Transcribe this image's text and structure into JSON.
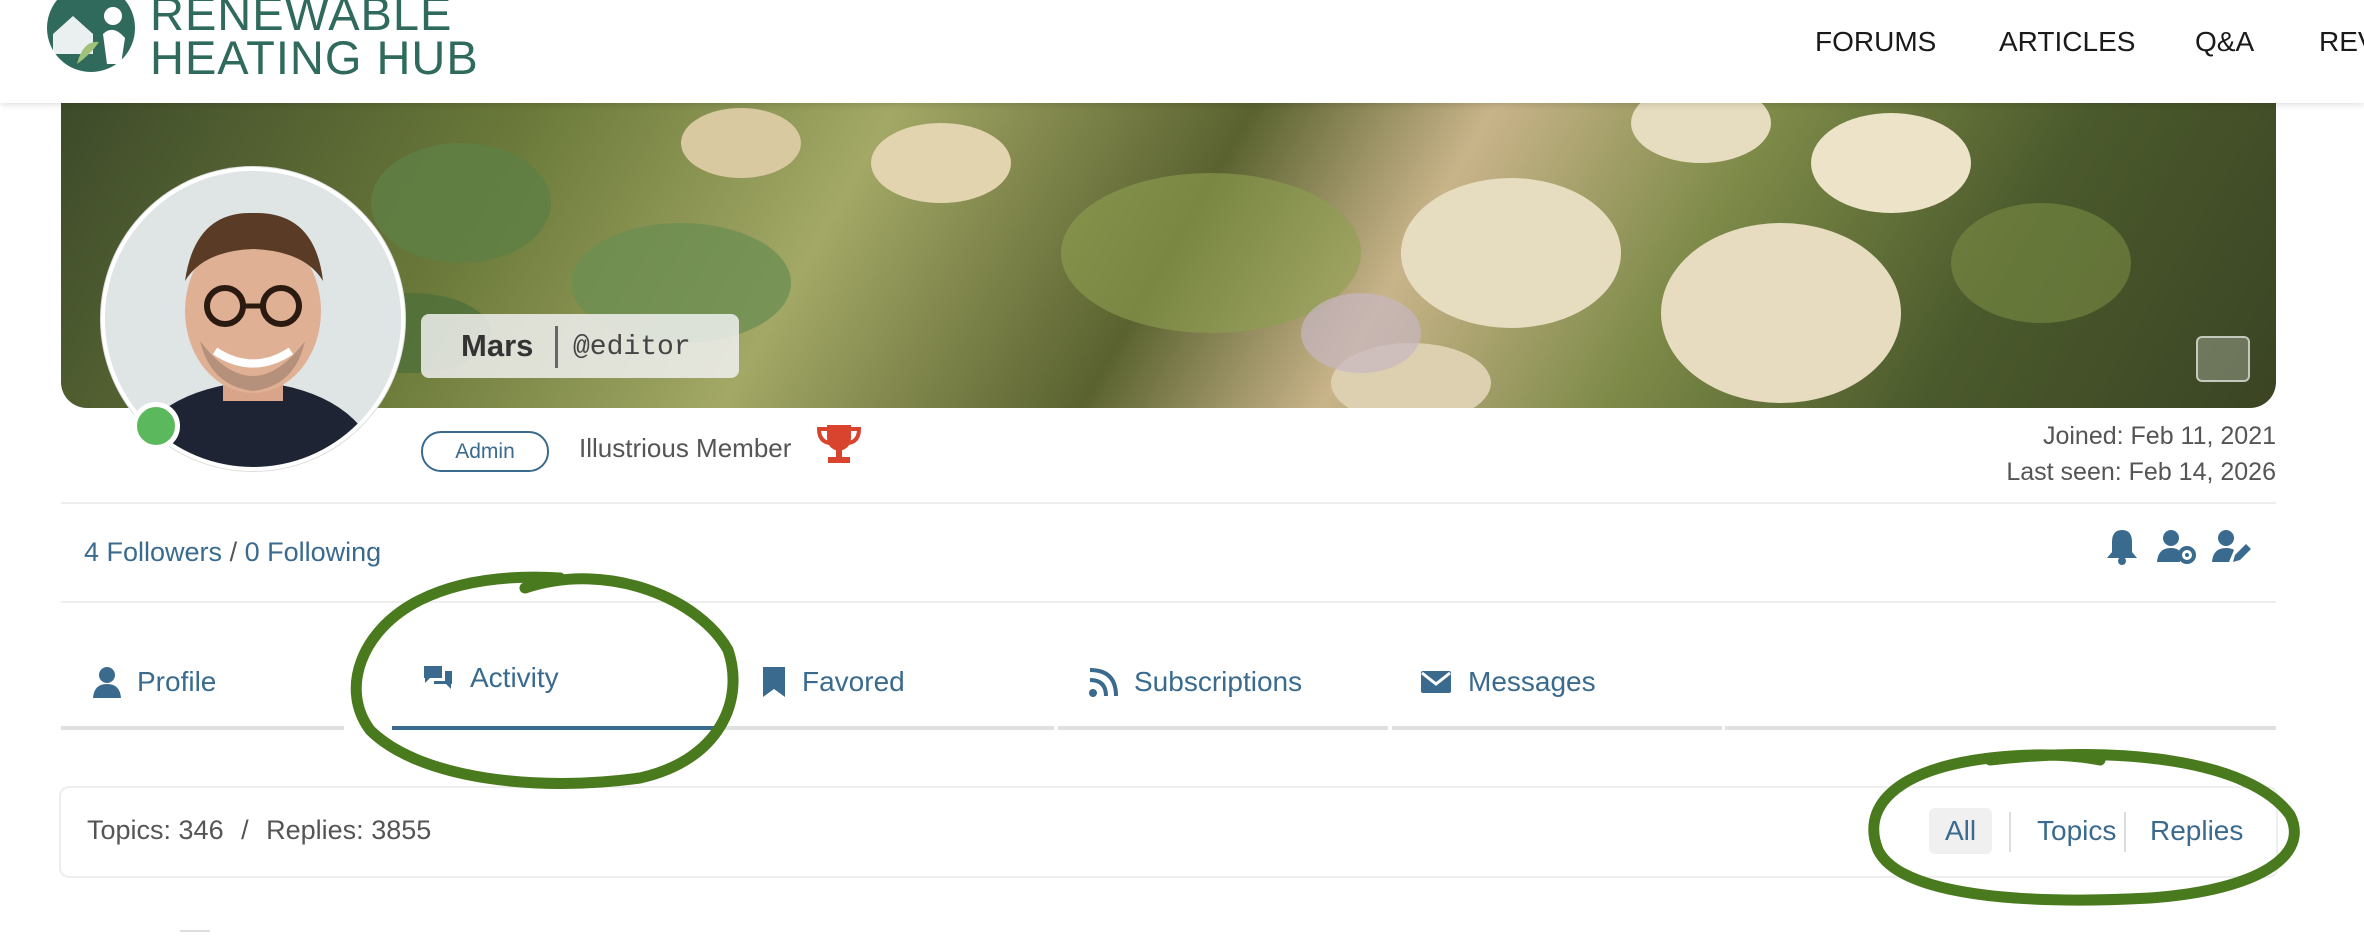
{
  "site": {
    "logo_line1": "RENEWABLE",
    "logo_line2": "HEATING HUB",
    "nav": [
      "FORUMS",
      "ARTICLES",
      "Q&A",
      "REV"
    ]
  },
  "profile": {
    "display_name": "Mars",
    "username": "@editor",
    "role": "Admin",
    "rank": "Illustrious Member",
    "joined": "Joined: Feb 11, 2021",
    "last_seen": "Last seen: Feb 14, 2026",
    "online": true
  },
  "follow": {
    "followers": "4 Followers",
    "separator": "/",
    "following": "0 Following"
  },
  "tabs": [
    {
      "label": "Profile",
      "icon": "user-icon"
    },
    {
      "label": "Activity",
      "icon": "comments-icon",
      "active": true
    },
    {
      "label": "Favored",
      "icon": "bookmark-icon"
    },
    {
      "label": "Subscriptions",
      "icon": "rss-icon"
    },
    {
      "label": "Messages",
      "icon": "envelope-icon"
    }
  ],
  "stats": {
    "topics": "Topics: 346",
    "separator": "/",
    "replies": "Replies: 3855"
  },
  "filters": [
    "All",
    "Topics",
    "Replies"
  ],
  "colors": {
    "accent": "#3a6b8f",
    "brand": "#2f6a5c",
    "online": "#5cb85c",
    "trophy": "#d9442f",
    "annotation": "#4a7a1e"
  }
}
